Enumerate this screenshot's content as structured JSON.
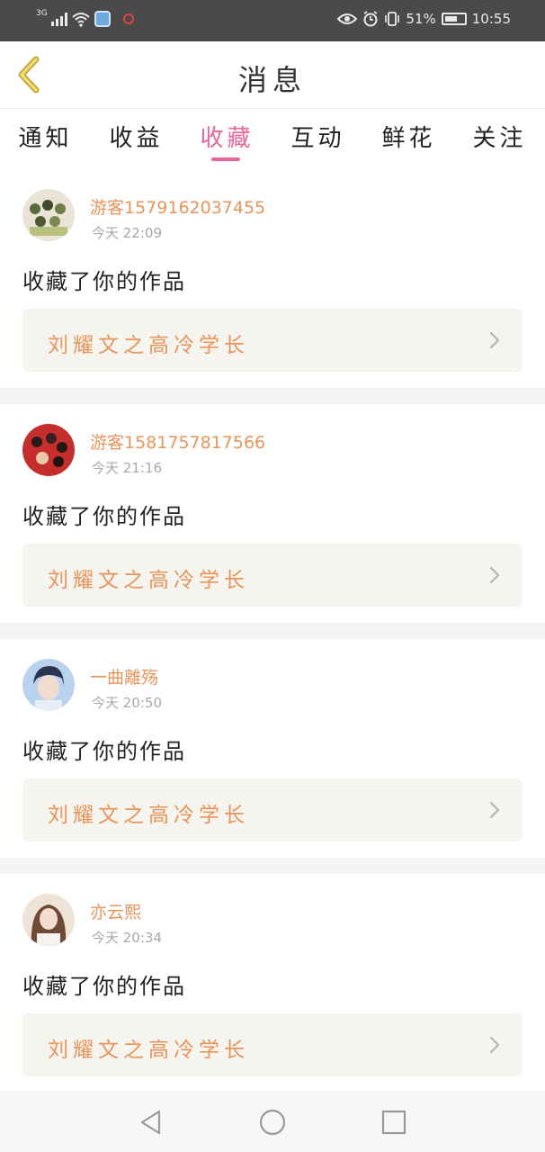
{
  "status_bar": {
    "network": "3G",
    "battery_percent": "51%",
    "time": "10:55",
    "icons": [
      "signal-icon",
      "wifi-icon",
      "app-icon",
      "record-icon",
      "eye-icon",
      "alarm-icon",
      "vibrate-icon",
      "battery-icon"
    ]
  },
  "header": {
    "title": "消息",
    "back_icon": "back-chevron-icon"
  },
  "tabs": [
    {
      "label": "通知",
      "active": false
    },
    {
      "label": "收益",
      "active": false
    },
    {
      "label": "收藏",
      "active": true
    },
    {
      "label": "互动",
      "active": false
    },
    {
      "label": "鲜花",
      "active": false
    },
    {
      "label": "关注",
      "active": false
    }
  ],
  "colors": {
    "accent": "#e8679a",
    "username": "#e8945a",
    "work_card_bg": "#f5f4ee"
  },
  "feed": [
    {
      "username": "游客1579162037455",
      "time": "今天 22:09",
      "action": "收藏了你的作品",
      "work_title": "刘耀文之高冷学长"
    },
    {
      "username": "游客1581757817566",
      "time": "今天 21:16",
      "action": "收藏了你的作品",
      "work_title": "刘耀文之高冷学长"
    },
    {
      "username": "一曲離殇",
      "time": "今天 20:50",
      "action": "收藏了你的作品",
      "work_title": "刘耀文之高冷学长"
    },
    {
      "username": "亦云熙",
      "time": "今天 20:34",
      "action": "收藏了你的作品",
      "work_title": "刘耀文之高冷学长"
    }
  ],
  "nav_bar": {
    "icons": [
      "nav-back-icon",
      "nav-home-icon",
      "nav-recents-icon"
    ]
  }
}
